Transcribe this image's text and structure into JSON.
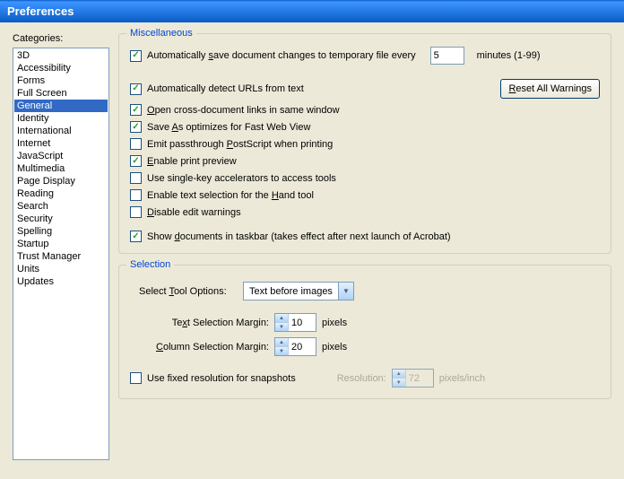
{
  "title": "Preferences",
  "categories_label": "Categories:",
  "categories": [
    "3D",
    "Accessibility",
    "Forms",
    "Full Screen",
    "General",
    "Identity",
    "International",
    "Internet",
    "JavaScript",
    "Multimedia",
    "Page Display",
    "Reading",
    "Search",
    "Security",
    "Spelling",
    "Startup",
    "Trust Manager",
    "Units",
    "Updates"
  ],
  "selected_category": "General",
  "misc": {
    "title": "Miscellaneous",
    "autosave": {
      "pre": "Automatically ",
      "u": "s",
      "post": "ave document changes to temporary file every",
      "checked": true,
      "value": "5",
      "suffix": "minutes (1-99)"
    },
    "detect_urls": {
      "text": "Automatically detect URLs from text",
      "checked": true
    },
    "cross_doc": {
      "pre": "",
      "u": "O",
      "post": "pen cross-document links in same window",
      "checked": true
    },
    "save_as": {
      "pre": "Save ",
      "u": "A",
      "post": "s optimizes for Fast Web View",
      "checked": true
    },
    "postscript": {
      "pre": "Emit passthrough ",
      "u": "P",
      "post": "ostScript when printing",
      "checked": false
    },
    "print_preview": {
      "pre": "",
      "u": "E",
      "post": "nable print preview",
      "checked": true
    },
    "single_key": {
      "text": "Use single-key accelerators to access tools",
      "checked": false
    },
    "hand_tool": {
      "pre": "Enable text selection for the ",
      "u": "H",
      "post": "and tool",
      "checked": false
    },
    "disable_warn": {
      "pre": "",
      "u": "D",
      "post": "isable edit warnings",
      "checked": false
    },
    "taskbar": {
      "pre": "Show ",
      "u": "d",
      "post": "ocuments in taskbar (takes effect after next launch of Acrobat)",
      "checked": true
    },
    "reset_btn": {
      "pre": "",
      "u": "R",
      "post": "eset All Warnings"
    }
  },
  "sel": {
    "title": "Selection",
    "tool_label": {
      "pre": "Select ",
      "u": "T",
      "post": "ool Options:"
    },
    "tool_value": "Text before images",
    "text_margin": {
      "pre": "Te",
      "u": "x",
      "post": "t Selection Margin:",
      "value": "10",
      "unit": "pixels"
    },
    "col_margin": {
      "pre": "",
      "u": "C",
      "post": "olumn Selection Margin:",
      "value": "20",
      "unit": "pixels"
    },
    "fixed_res": {
      "text": "Use fixed resolution for snapshots",
      "checked": false
    },
    "res_label": "Resolution:",
    "res_value": "72",
    "res_unit": "pixels/inch"
  }
}
